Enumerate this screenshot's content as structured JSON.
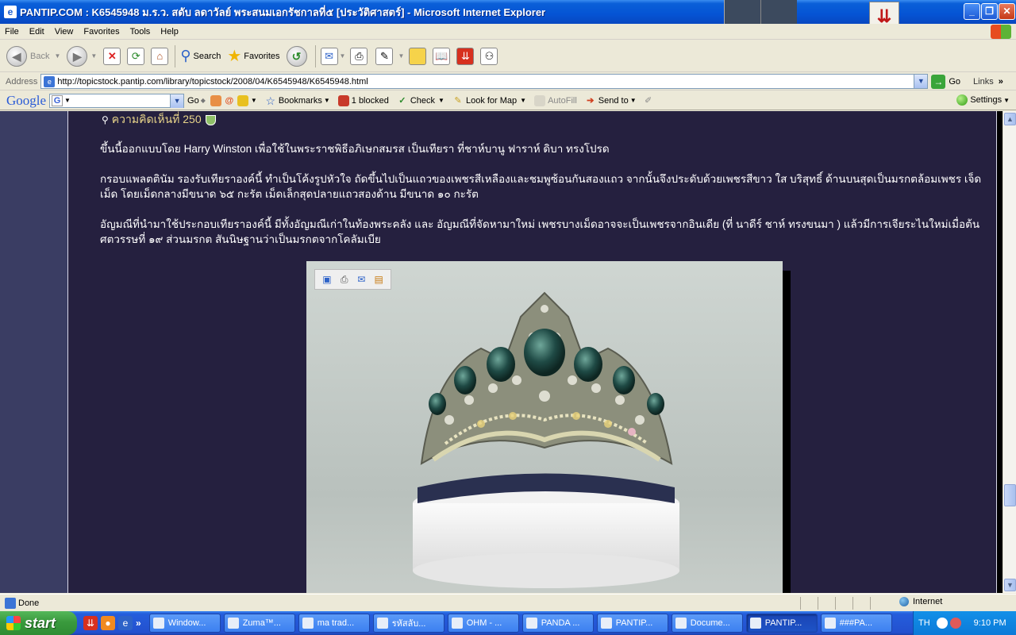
{
  "window": {
    "title": "PANTIP.COM : K6545948 ม.ร.ว. สดับ ลดาวัลย์ พระสนมเอกรัชกาลที่๕ [ประวัติศาสตร์] - Microsoft Internet Explorer",
    "minimize": "_",
    "restore": "❐",
    "close": "✕"
  },
  "menu": [
    "File",
    "Edit",
    "View",
    "Favorites",
    "Tools",
    "Help"
  ],
  "toolbar": {
    "back": "Back",
    "search": "Search",
    "favorites": "Favorites"
  },
  "address": {
    "label": "Address",
    "url": "http://topicstock.pantip.com/library/topicstock/2008/04/K6545948/K6545948.html",
    "go": "Go",
    "links": "Links"
  },
  "google_toolbar": {
    "logo": "Google",
    "go": "Go",
    "bookmarks": "Bookmarks",
    "blocked": "1 blocked",
    "check": "Check",
    "look_for_map": "Look for Map",
    "autofill": "AutoFill",
    "send_to": "Send to",
    "settings": "Settings"
  },
  "page": {
    "comment_header": "ความคิดเห็นที่ 250",
    "paragraphs": [
      "ขึ้นนี้ออกแบบโดย Harry Winston เพื่อใช้ในพระราชพิธีอภิเษกสมรส เป็นเทียรา ที่ชาห์บานู ฟาราห์ ดิบา ทรงโปรด",
      "กรอบแพลตตินัม รองรับเทียราองค์นี้ ทำเป็นโค้งรูปหัวใจ ถัดขึ้นไปเป็นแถวของเพชรสีเหลืองและชมพูซ้อนกันสองแถว จากนั้นจึงประดับด้วยเพชรสีขาว ใส บริสุทธิ์ ด้านบนสุดเป็นมรกตล้อมเพชร เจ็ดเม็ด โดยเม็ดกลางมีขนาด ๖๕ กะรัต เม็ดเล็กสุดปลายแถวสองด้าน มีขนาด ๑๐ กะรัต",
      "อัญมณีที่นำมาใช้ประกอบเทียราองค์นี้ มีทั้งอัญมณีเก่าในท้องพระคลัง และ อัญมณีที่จัดหามาใหม่ เพชรบางเม็ดอาจจะเป็นเพชรจากอินเดีย (ที่ นาดีร์ ชาห์ ทรงขนมา ) แล้วมีการเจียระไนใหม่เมื่อต้นศตวรรษที่ ๑๙ ส่วนมรกต สันนิษฐานว่าเป็นมรกตจากโคลัมเบีย"
    ]
  },
  "status": {
    "text": "Done",
    "zone": "Internet"
  },
  "taskbar": {
    "start": "start",
    "buttons": [
      {
        "label": "Window...",
        "active": false
      },
      {
        "label": "Zuma™...",
        "active": false
      },
      {
        "label": "ma trad...",
        "active": false
      },
      {
        "label": "รหัสลับ...",
        "active": false
      },
      {
        "label": "OHM - ...",
        "active": false
      },
      {
        "label": "PANDA ...",
        "active": false
      },
      {
        "label": "PANTIP...",
        "active": false
      },
      {
        "label": "Docume...",
        "active": false
      },
      {
        "label": "PANTIP...",
        "active": true
      },
      {
        "label": "###PA...",
        "active": false
      }
    ],
    "lang": "TH",
    "clock": "9:10 PM"
  },
  "colors": {
    "page_bg": "#25203f",
    "side_column": "#3a3d63",
    "comment_header": "#e8d48a",
    "titlebar": "#0554d4"
  }
}
